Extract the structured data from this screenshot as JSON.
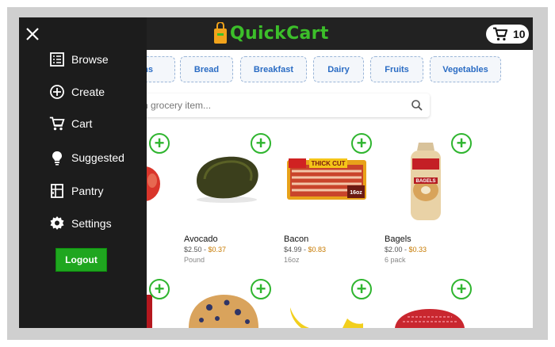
{
  "header": {
    "app_name": "QuickCart",
    "cart_count": "10"
  },
  "categories": [
    "ins",
    "Bread",
    "Breakfast",
    "Dairy",
    "Fruits",
    "Vegetables"
  ],
  "search": {
    "placeholder": "ch grocery item..."
  },
  "products": [
    {
      "name": "Avocado",
      "price_low": "$2.50",
      "sep": " - ",
      "price_high": "$0.37",
      "unit": "Pound"
    },
    {
      "name": "Bacon",
      "price_low": "$4.99",
      "sep": " - ",
      "price_high": "$0.83",
      "unit": "16oz"
    },
    {
      "name": "Bagels",
      "price_low": "$2.00",
      "sep": " - ",
      "price_high": "$0.33",
      "unit": "6 pack"
    }
  ],
  "package_labels": {
    "bacon_top": "THICK CUT",
    "bacon_size": "16oz",
    "bagels": "BAGELS"
  },
  "drawer": {
    "items": [
      {
        "label": "Browse",
        "icon": "browse-icon"
      },
      {
        "label": "Create",
        "icon": "plus-circle-icon"
      },
      {
        "label": "Cart",
        "icon": "cart-icon"
      },
      {
        "label": "Suggested",
        "icon": "lightbulb-icon"
      },
      {
        "label": "Pantry",
        "icon": "pantry-icon"
      },
      {
        "label": "Settings",
        "icon": "gear-icon"
      }
    ],
    "logout_label": "Logout"
  },
  "colors": {
    "brand_green": "#3cbf2a",
    "topbar": "#222222",
    "drawer": "#1c1c1c",
    "category_text": "#2a6cc4"
  }
}
